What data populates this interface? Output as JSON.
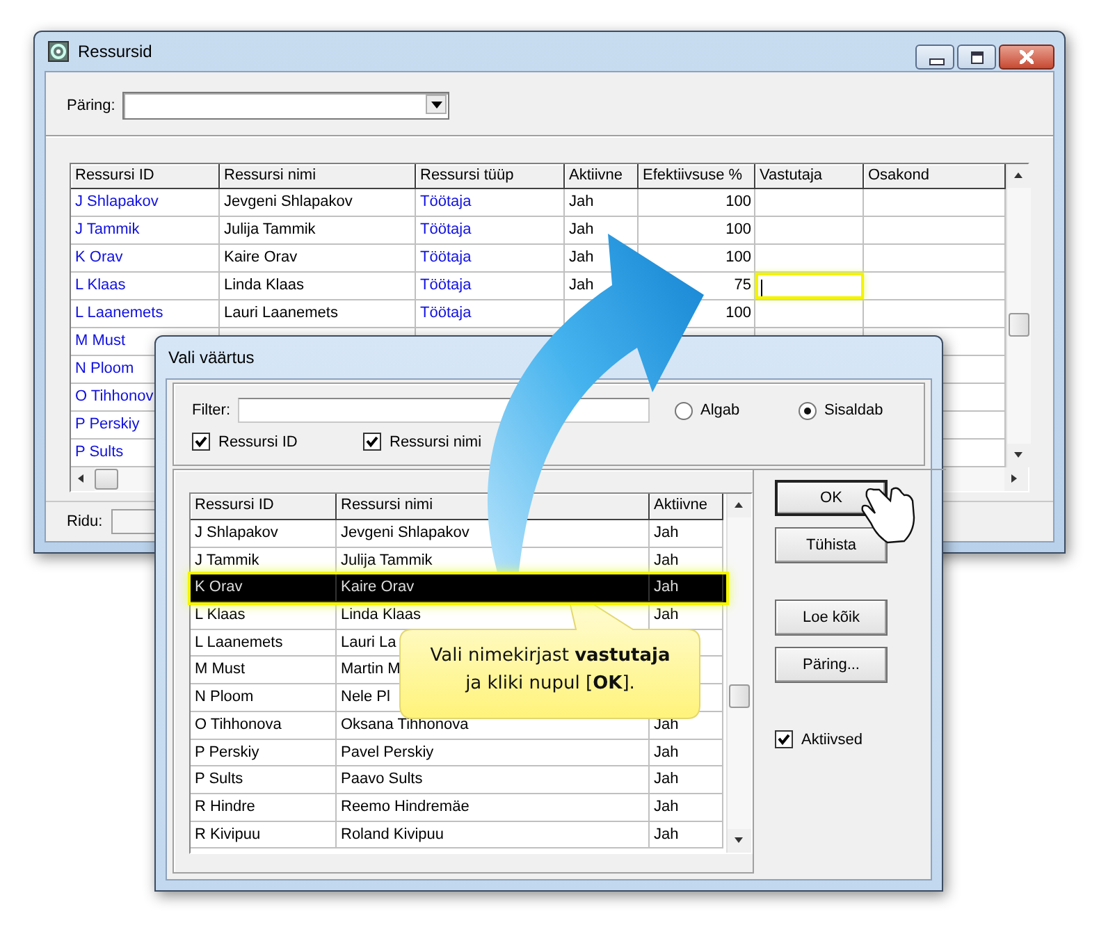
{
  "main_window": {
    "title": "Ressursid",
    "query": {
      "label": "Päring:"
    },
    "table": {
      "columns": [
        {
          "label": "Ressursi ID",
          "kind": "link"
        },
        {
          "label": "Ressursi nimi",
          "kind": "text"
        },
        {
          "label": "Ressursi tüüp",
          "kind": "link"
        },
        {
          "label": "Aktiivne",
          "kind": "text"
        },
        {
          "label": "Efektiivsuse %",
          "kind": "number"
        },
        {
          "label": "Vastutaja",
          "kind": "lookup"
        },
        {
          "label": "Osakond",
          "kind": "text"
        }
      ],
      "rows": [
        {
          "cells": [
            "J Shlapakov",
            "Jevgeni Shlapakov",
            "Töötaja",
            "Jah",
            "100",
            null,
            null
          ],
          "editing": false
        },
        {
          "cells": [
            "J Tammik",
            "Julija Tammik",
            "Töötaja",
            "Jah",
            "100",
            null,
            null
          ],
          "editing": false
        },
        {
          "cells": [
            "K Orav",
            "Kaire Orav",
            "Töötaja",
            "Jah",
            "100",
            null,
            null
          ],
          "editing": false
        },
        {
          "cells": [
            "L Klaas",
            "Linda Klaas",
            "Töötaja",
            "Jah",
            "75",
            null,
            null
          ],
          "editing": true
        },
        {
          "cells": [
            "L Laanemets",
            "Lauri Laanemets",
            "Töötaja",
            null,
            "100",
            null,
            null
          ],
          "editing": false
        },
        {
          "cells": [
            "M Must",
            null,
            null,
            null,
            null,
            null,
            null
          ]
        },
        {
          "cells": [
            "N Ploom",
            null,
            null,
            null,
            null,
            null,
            null
          ]
        },
        {
          "cells": [
            "O Tihhonov",
            null,
            null,
            null,
            null,
            null,
            null
          ]
        },
        {
          "cells": [
            "P Perskiy",
            null,
            null,
            null,
            null,
            null,
            null
          ]
        },
        {
          "cells": [
            "P Sults",
            null,
            null,
            null,
            null,
            null,
            null
          ]
        }
      ]
    },
    "status": {
      "label": "Ridu:"
    }
  },
  "dialog": {
    "title": "Vali väärtus",
    "filter": {
      "label": "Filter:"
    },
    "match_modes": [
      {
        "label": "Algab",
        "selected": false
      },
      {
        "label": "Sisaldab",
        "selected": true
      }
    ],
    "search_columns": [
      {
        "label": "Ressursi ID",
        "checked": true
      },
      {
        "label": "Ressursi nimi",
        "checked": true
      }
    ],
    "list": {
      "columns": [
        "Ressursi ID",
        "Ressursi nimi",
        "Aktiivne"
      ],
      "rows": [
        {
          "cells": [
            "J Shlapakov",
            "Jevgeni Shlapakov",
            "Jah"
          ],
          "selected": false
        },
        {
          "cells": [
            "J Tammik",
            "Julija Tammik",
            "Jah"
          ],
          "selected": false
        },
        {
          "cells": [
            "K Orav",
            "Kaire Orav",
            "Jah"
          ],
          "selected": true
        },
        {
          "cells": [
            "L Klaas",
            "Linda Klaas",
            "Jah"
          ],
          "selected": false
        },
        {
          "cells": [
            "L Laanemets",
            "Lauri La",
            null
          ],
          "selected": false
        },
        {
          "cells": [
            "M Must",
            "Martin M",
            null
          ],
          "selected": false
        },
        {
          "cells": [
            "N Ploom",
            "Nele Pl",
            null
          ],
          "selected": false
        },
        {
          "cells": [
            "O Tihhonova",
            "Oksana Tihhonova",
            "Jah"
          ],
          "selected": false
        },
        {
          "cells": [
            "P Perskiy",
            "Pavel Perskiy",
            "Jah"
          ],
          "selected": false
        },
        {
          "cells": [
            "P Sults",
            "Paavo Sults",
            "Jah"
          ],
          "selected": false
        },
        {
          "cells": [
            "R Hindre",
            "Reemo Hindremäe",
            "Jah"
          ],
          "selected": false
        },
        {
          "cells": [
            "R Kivipuu",
            "Roland Kivipuu",
            "Jah"
          ],
          "selected": false
        }
      ]
    },
    "buttons": [
      {
        "label": "OK",
        "kind": "primary"
      },
      {
        "label": "Tühista",
        "kind": "normal"
      },
      {
        "label": "Loe kõik",
        "kind": "spaced"
      },
      {
        "label": "Päring...",
        "kind": "normal"
      }
    ],
    "active_only": {
      "label": "Aktiivsed",
      "checked": true
    }
  },
  "callout": {
    "text": "Vali nimekirjast **vastutaja** ja kliki nupul [**OK**]."
  }
}
